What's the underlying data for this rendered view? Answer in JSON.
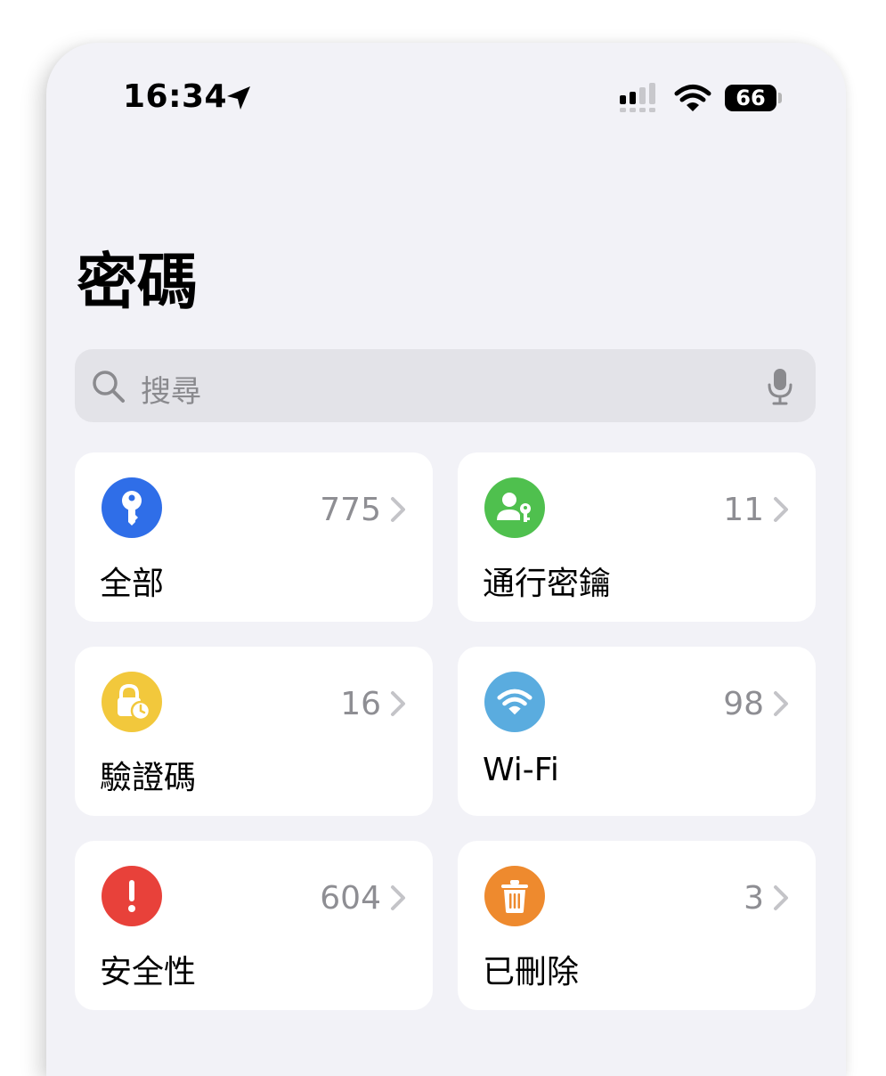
{
  "status_bar": {
    "time": "16:34",
    "battery": "66"
  },
  "title": "密碼",
  "search": {
    "placeholder": "搜尋"
  },
  "categories": [
    {
      "label": "全部",
      "count": "775",
      "icon": "key-icon",
      "color": "#2f6ee8"
    },
    {
      "label": "通行密鑰",
      "count": "11",
      "icon": "person-key-icon",
      "color": "#4fc04e"
    },
    {
      "label": "驗證碼",
      "count": "16",
      "icon": "lock-clock-icon",
      "color": "#f2c83c"
    },
    {
      "label": "Wi-Fi",
      "count": "98",
      "icon": "wifi-icon",
      "color": "#5aacdf"
    },
    {
      "label": "安全性",
      "count": "604",
      "icon": "exclamation-icon",
      "color": "#e8413a"
    },
    {
      "label": "已刪除",
      "count": "3",
      "icon": "trash-icon",
      "color": "#ee8a2e"
    }
  ]
}
